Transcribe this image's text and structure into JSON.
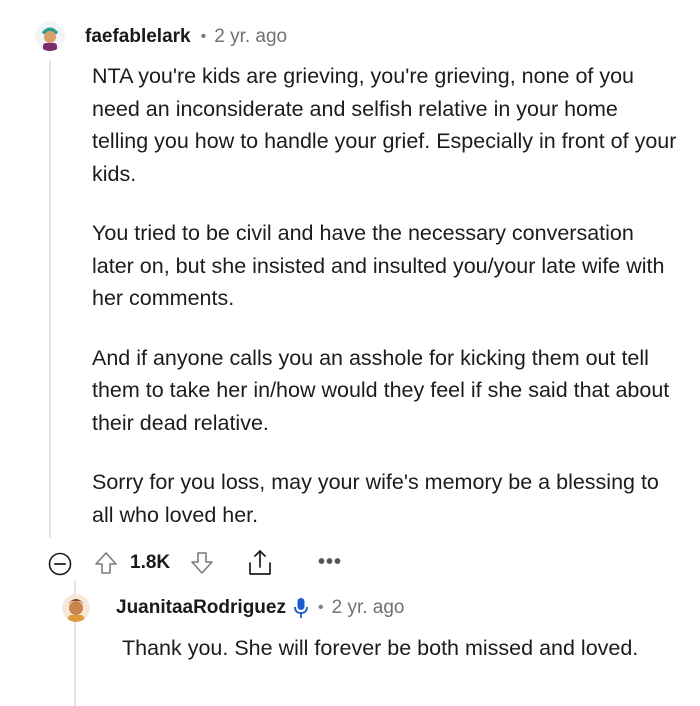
{
  "comment": {
    "username": "faefablelark",
    "separator": "•",
    "time": "2 yr. ago",
    "paragraphs": [
      "NTA you're kids are grieving, you're grieving, none of you need an inconsiderate and selfish relative in your home telling you how to handle your grief. Especially in front of your kids.",
      "You tried to be civil and have the necessary conversation later on, but she insisted and insulted you/your late wife with her comments.",
      "And if anyone calls you an asshole for kicking them out tell them to take her in/how would they feel if she said that about their dead relative.",
      "Sorry for you loss, may your wife's memory be a blessing to all who loved her."
    ],
    "actions": {
      "score": "1.8K",
      "more": "•••"
    }
  },
  "reply": {
    "username": "JuanitaaRodriguez",
    "separator": "•",
    "time": "2 yr. ago",
    "text": "Thank you. She will forever be both missed and loved.",
    "badge_icon": "microphone-icon"
  },
  "colors": {
    "upvote_outline": "#7c7c7c",
    "text": "#1c1c1c",
    "meta": "#6f7275",
    "mod_badge": "#1a5ccc"
  }
}
